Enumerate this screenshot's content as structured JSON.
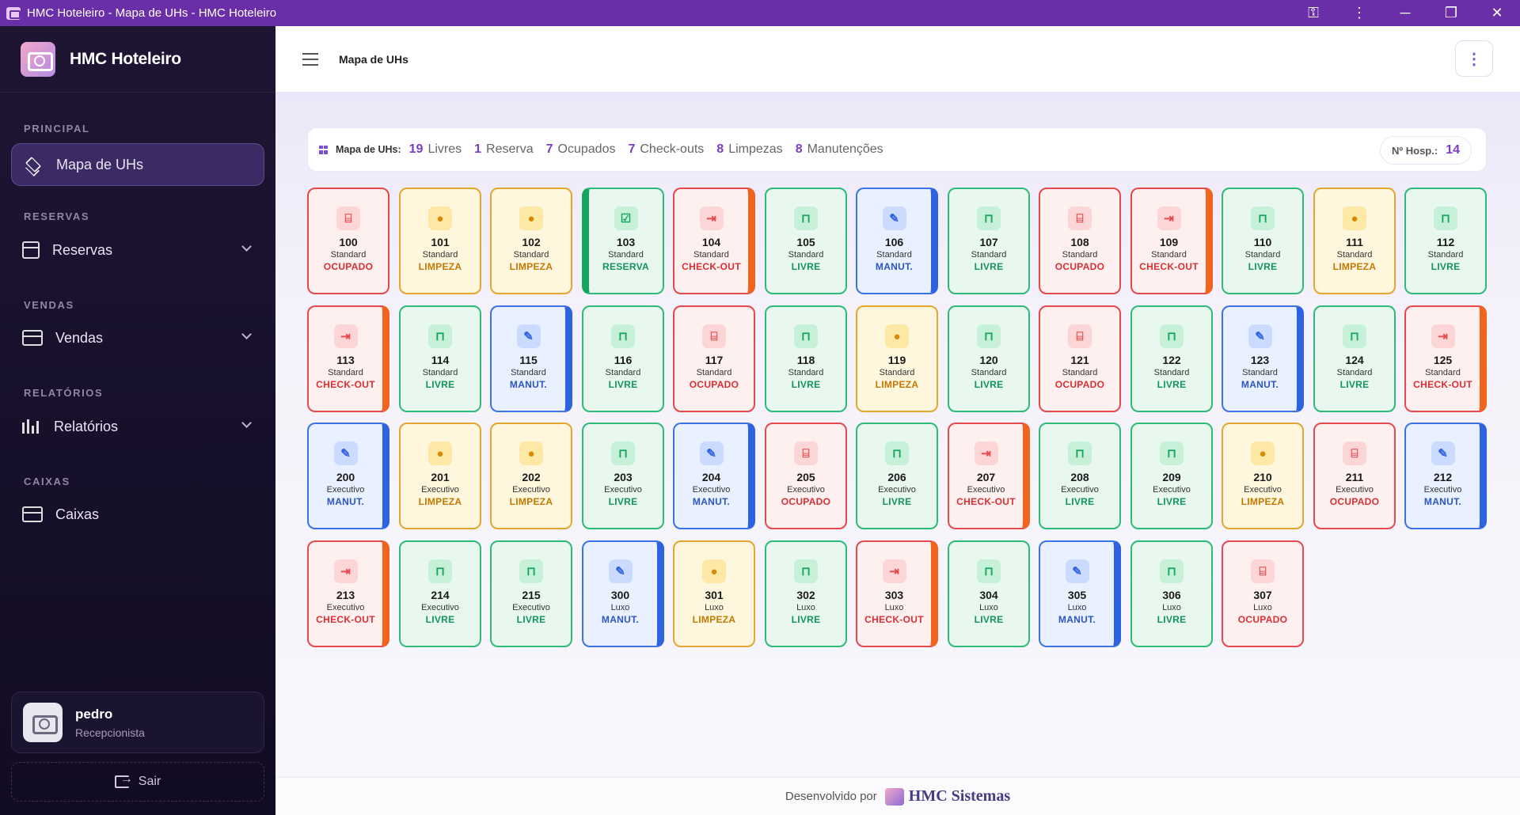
{
  "window": {
    "title": "HMC Hoteleiro - Mapa de UHs - HMC Hoteleiro",
    "key_icon": "key-icon",
    "menu_icon": "vertical-dots-icon",
    "minimize": "─",
    "maximize": "❐",
    "close": "✕"
  },
  "brand": {
    "name": "HMC Hoteleiro"
  },
  "sidebar": {
    "sections": {
      "principal": "PRINCIPAL",
      "reservas": "RESERVAS",
      "vendas": "VENDAS",
      "relatorios": "RELATÓRIOS",
      "caixas": "CAIXAS"
    },
    "items": {
      "mapa": "Mapa de UHs",
      "reservas": "Reservas",
      "vendas": "Vendas",
      "relatorios": "Relatórios",
      "caixas": "Caixas"
    }
  },
  "user": {
    "name": "pedro",
    "role": "Recepcionista"
  },
  "logout": {
    "label": "Sair"
  },
  "header": {
    "title": "Mapa de UHs",
    "menu_icon": "⋮"
  },
  "summary": {
    "label": "Mapa de UHs:",
    "stats": [
      {
        "count": "19",
        "label": "Livres"
      },
      {
        "count": "1",
        "label": "Reserva"
      },
      {
        "count": "7",
        "label": "Ocupados"
      },
      {
        "count": "7",
        "label": "Check-outs"
      },
      {
        "count": "8",
        "label": "Limpezas"
      },
      {
        "count": "8",
        "label": "Manutenções"
      }
    ],
    "hosp_label": "Nº Hosp.:",
    "hosp_count": "14"
  },
  "status_icons": {
    "ocupado": "bed-icon",
    "limpeza": "drop-icon",
    "livre": "unlock-icon",
    "reserva": "calendar-check-icon",
    "checkout": "exit-icon",
    "manut": "wrench-icon"
  },
  "status_glyphs": {
    "ocupado": "⌸",
    "limpeza": "●",
    "livre": "⊓",
    "reserva": "☑",
    "checkout": "⇥",
    "manut": "✎"
  },
  "rooms": [
    {
      "num": "100",
      "type": "Standard",
      "status": "ocupado",
      "label": "OCUPADO"
    },
    {
      "num": "101",
      "type": "Standard",
      "status": "limpeza",
      "label": "LIMPEZA"
    },
    {
      "num": "102",
      "type": "Standard",
      "status": "limpeza",
      "label": "LIMPEZA"
    },
    {
      "num": "103",
      "type": "Standard",
      "status": "reserva",
      "label": "RESERVA"
    },
    {
      "num": "104",
      "type": "Standard",
      "status": "checkout",
      "label": "CHECK-OUT"
    },
    {
      "num": "105",
      "type": "Standard",
      "status": "livre",
      "label": "LIVRE"
    },
    {
      "num": "106",
      "type": "Standard",
      "status": "manut",
      "label": "MANUT."
    },
    {
      "num": "107",
      "type": "Standard",
      "status": "livre",
      "label": "LIVRE"
    },
    {
      "num": "108",
      "type": "Standard",
      "status": "ocupado",
      "label": "OCUPADO"
    },
    {
      "num": "109",
      "type": "Standard",
      "status": "checkout",
      "label": "CHECK-OUT"
    },
    {
      "num": "110",
      "type": "Standard",
      "status": "livre",
      "label": "LIVRE"
    },
    {
      "num": "111",
      "type": "Standard",
      "status": "limpeza",
      "label": "LIMPEZA"
    },
    {
      "num": "112",
      "type": "Standard",
      "status": "livre",
      "label": "LIVRE"
    },
    {
      "num": "113",
      "type": "Standard",
      "status": "checkout",
      "label": "CHECK-OUT"
    },
    {
      "num": "114",
      "type": "Standard",
      "status": "livre",
      "label": "LIVRE"
    },
    {
      "num": "115",
      "type": "Standard",
      "status": "manut",
      "label": "MANUT."
    },
    {
      "num": "116",
      "type": "Standard",
      "status": "livre",
      "label": "LIVRE"
    },
    {
      "num": "117",
      "type": "Standard",
      "status": "ocupado",
      "label": "OCUPADO"
    },
    {
      "num": "118",
      "type": "Standard",
      "status": "livre",
      "label": "LIVRE"
    },
    {
      "num": "119",
      "type": "Standard",
      "status": "limpeza",
      "label": "LIMPEZA"
    },
    {
      "num": "120",
      "type": "Standard",
      "status": "livre",
      "label": "LIVRE"
    },
    {
      "num": "121",
      "type": "Standard",
      "status": "ocupado",
      "label": "OCUPADO"
    },
    {
      "num": "122",
      "type": "Standard",
      "status": "livre",
      "label": "LIVRE"
    },
    {
      "num": "123",
      "type": "Standard",
      "status": "manut",
      "label": "MANUT."
    },
    {
      "num": "124",
      "type": "Standard",
      "status": "livre",
      "label": "LIVRE"
    },
    {
      "num": "125",
      "type": "Standard",
      "status": "checkout",
      "label": "CHECK-OUT"
    },
    {
      "num": "200",
      "type": "Executivo",
      "status": "manut",
      "label": "MANUT."
    },
    {
      "num": "201",
      "type": "Executivo",
      "status": "limpeza",
      "label": "LIMPEZA"
    },
    {
      "num": "202",
      "type": "Executivo",
      "status": "limpeza",
      "label": "LIMPEZA"
    },
    {
      "num": "203",
      "type": "Executivo",
      "status": "livre",
      "label": "LIVRE"
    },
    {
      "num": "204",
      "type": "Executivo",
      "status": "manut",
      "label": "MANUT."
    },
    {
      "num": "205",
      "type": "Executivo",
      "status": "ocupado",
      "label": "OCUPADO"
    },
    {
      "num": "206",
      "type": "Executivo",
      "status": "livre",
      "label": "LIVRE"
    },
    {
      "num": "207",
      "type": "Executivo",
      "status": "checkout",
      "label": "CHECK-OUT"
    },
    {
      "num": "208",
      "type": "Executivo",
      "status": "livre",
      "label": "LIVRE"
    },
    {
      "num": "209",
      "type": "Executivo",
      "status": "livre",
      "label": "LIVRE"
    },
    {
      "num": "210",
      "type": "Executivo",
      "status": "limpeza",
      "label": "LIMPEZA"
    },
    {
      "num": "211",
      "type": "Executivo",
      "status": "ocupado",
      "label": "OCUPADO"
    },
    {
      "num": "212",
      "type": "Executivo",
      "status": "manut",
      "label": "MANUT."
    },
    {
      "num": "213",
      "type": "Executivo",
      "status": "checkout",
      "label": "CHECK-OUT"
    },
    {
      "num": "214",
      "type": "Executivo",
      "status": "livre",
      "label": "LIVRE"
    },
    {
      "num": "215",
      "type": "Executivo",
      "status": "livre",
      "label": "LIVRE"
    },
    {
      "num": "300",
      "type": "Luxo",
      "status": "manut",
      "label": "MANUT."
    },
    {
      "num": "301",
      "type": "Luxo",
      "status": "limpeza",
      "label": "LIMPEZA"
    },
    {
      "num": "302",
      "type": "Luxo",
      "status": "livre",
      "label": "LIVRE"
    },
    {
      "num": "303",
      "type": "Luxo",
      "status": "checkout",
      "label": "CHECK-OUT"
    },
    {
      "num": "304",
      "type": "Luxo",
      "status": "livre",
      "label": "LIVRE"
    },
    {
      "num": "305",
      "type": "Luxo",
      "status": "manut",
      "label": "MANUT."
    },
    {
      "num": "306",
      "type": "Luxo",
      "status": "livre",
      "label": "LIVRE"
    },
    {
      "num": "307",
      "type": "Luxo",
      "status": "ocupado",
      "label": "OCUPADO"
    }
  ],
  "footer": {
    "prefix": "Desenvolvido por",
    "brand": "HMC Sistemas"
  },
  "colors": {
    "accent": "#6a2fa8",
    "livre": "#2ebb79",
    "ocupado": "#e5484d",
    "limpeza": "#e3a72f",
    "manut": "#3b73e6",
    "checkout": "#f0641e"
  }
}
